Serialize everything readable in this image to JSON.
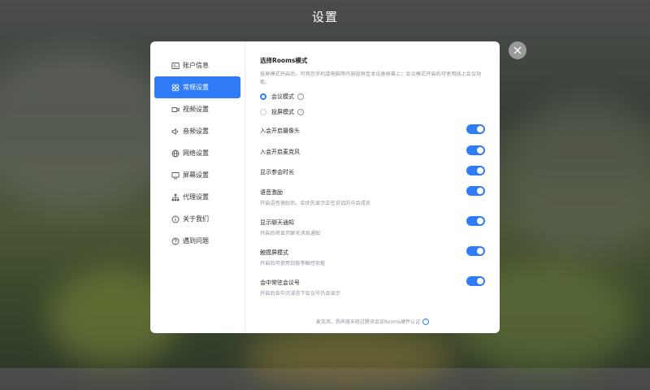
{
  "header": {
    "title": "设置"
  },
  "sidebar": {
    "items": [
      {
        "label": "账户信息",
        "icon": "account-card-icon",
        "active": false
      },
      {
        "label": "常规设置",
        "icon": "grid-icon",
        "active": true
      },
      {
        "label": "视频设置",
        "icon": "video-camera-icon",
        "active": false
      },
      {
        "label": "音频设置",
        "icon": "speaker-icon",
        "active": false
      },
      {
        "label": "网络设置",
        "icon": "globe-icon",
        "active": false
      },
      {
        "label": "屏幕设置",
        "icon": "monitor-icon",
        "active": false
      },
      {
        "label": "代理设置",
        "icon": "network-tree-icon",
        "active": false
      },
      {
        "label": "关于我们",
        "icon": "info-icon",
        "active": false
      },
      {
        "label": "遇到问题",
        "icon": "help-icon",
        "active": false
      }
    ]
  },
  "mode": {
    "title": "选择Rooms模式",
    "description": "投屏模式开启后，可将您手机或电脑等内容投屏至本设备屏幕上；会议模式开启后可使用线上会议功能。",
    "options": [
      {
        "label": "会议模式",
        "checked": true
      },
      {
        "label": "投屏模式",
        "checked": false
      }
    ]
  },
  "toggles": [
    {
      "label": "入会开启摄像头",
      "description": "",
      "on": true
    },
    {
      "label": "入会开启麦克风",
      "description": "",
      "on": true
    },
    {
      "label": "显示参会时长",
      "description": "",
      "on": true
    },
    {
      "label": "语音激励",
      "description": "开启语音激励后，会优先显示正在说话的与会成员",
      "on": true
    },
    {
      "label": "显示聊天通知",
      "description": "开启后将显示聊天消息通知",
      "on": true
    },
    {
      "label": "触摸屏模式",
      "description": "开启后可使用白板等触控功能",
      "on": true
    },
    {
      "label": "会中常驻会议号",
      "description": "开启后会中沉浸态下会议号仍会显示",
      "on": true
    }
  ],
  "footer": {
    "note": "麦克风、扬声器未经过腾讯会议Rooms硬件认证"
  },
  "colors": {
    "accent": "#2f7cf6",
    "text": "#1f2329",
    "muted": "#8f959e"
  }
}
